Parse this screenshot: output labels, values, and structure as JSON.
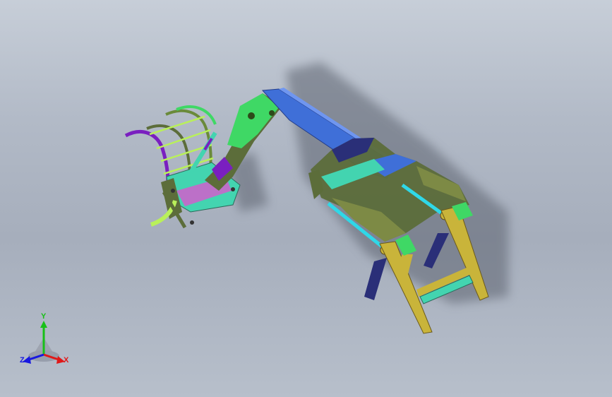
{
  "viewport": {
    "background_top": "#c7ced8",
    "background_bottom": "#a6aebc"
  },
  "model": {
    "colors": {
      "boom_blue": "#3f6fd8",
      "frame_olive": "#5c6d3a",
      "bracket_yellow": "#c9b43a",
      "cylinder_cyan": "#2fd8e8",
      "pad_navy": "#2a2f78",
      "grapple_purple": "#8a2bd0",
      "link_green": "#3fd865",
      "rod_lime": "#b9f05a"
    }
  },
  "triad": {
    "x_label": "X",
    "y_label": "Y",
    "z_label": "Z",
    "x_color": "#e01818",
    "y_color": "#18c018",
    "z_color": "#1818e0"
  }
}
